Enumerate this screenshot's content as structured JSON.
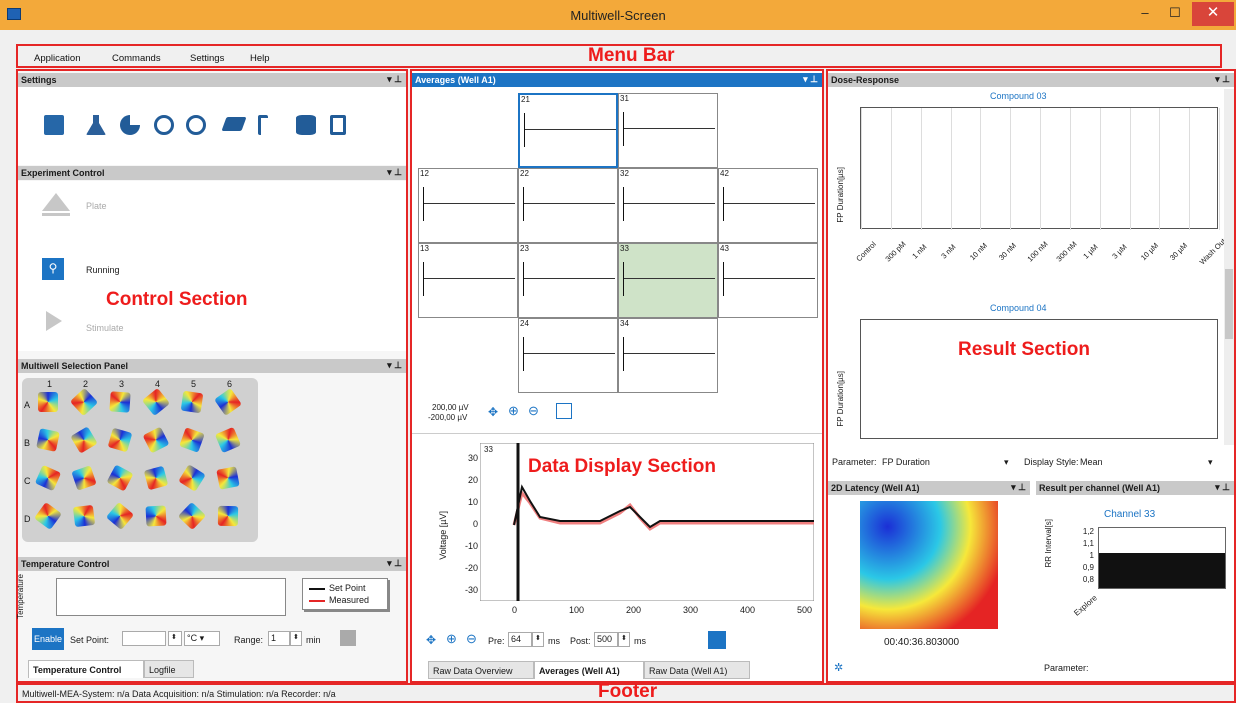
{
  "window": {
    "title": "Multiwell-Screen",
    "minimize": "–",
    "maximize": "☐",
    "close": "✕"
  },
  "menu": [
    "Application",
    "Commands",
    "Settings",
    "Help"
  ],
  "overlays": {
    "menu_bar": "Menu Bar",
    "control_section": "Control Section",
    "data_display_section": "Data Display Section",
    "result_section": "Result Section",
    "footer": "Footer"
  },
  "settings_panel": {
    "title": "Settings",
    "icons": [
      "book-icon",
      "flask-icon",
      "pie-icon",
      "zoom-chart-icon",
      "eraser-icon",
      "pulse-icon",
      "database-icon",
      "clipboard-icon"
    ]
  },
  "experiment_control": {
    "title": "Experiment Control",
    "plate": "Plate",
    "running": "Running",
    "stimulate": "Stimulate"
  },
  "multiwell_panel": {
    "title": "Multiwell Selection Panel",
    "cols": [
      "1",
      "2",
      "3",
      "4",
      "5",
      "6"
    ],
    "rows": [
      "A",
      "B",
      "C",
      "D"
    ]
  },
  "temperature": {
    "title": "Temperature Control",
    "axis": "Temperature",
    "legend_set": "Set Point",
    "legend_measured": "Measured",
    "enable": "Enable",
    "set_point_label": "Set Point:",
    "unit": "°C",
    "range_label": "Range:",
    "range_value": "1",
    "min": "min",
    "tabs": [
      "Temperature Control",
      "Logfile"
    ]
  },
  "averages": {
    "title": "Averages (Well A1)",
    "cells": [
      "21",
      "31",
      "12",
      "22",
      "32",
      "42",
      "13",
      "23",
      "33",
      "43",
      "24",
      "34"
    ],
    "scale_top": "200,00 µV",
    "scale_bottom": "-200,00 µV"
  },
  "detail_plot": {
    "channel": "33",
    "ylabel": "Voltage [µV]",
    "yticks": [
      "30",
      "20",
      "10",
      "0",
      "-10",
      "-20",
      "-30"
    ],
    "xticks": [
      "0",
      "100",
      "200",
      "300",
      "400",
      "500"
    ]
  },
  "data_controls": {
    "pre_label": "Pre:",
    "pre_value": "64",
    "post_label": "Post:",
    "post_value": "500",
    "unit": "ms",
    "tabs": [
      "Raw Data Overview",
      "Averages (Well A1)",
      "Raw Data (Well A1)"
    ]
  },
  "dose_response": {
    "title": "Dose-Response",
    "compound1": "Compound 03",
    "compound2": "Compound 04",
    "ylabel": "FP Duration[µs]",
    "xticks": [
      "Control",
      "300 pM",
      "1 nM",
      "3 nM",
      "10 nM",
      "30 nM",
      "100 nM",
      "300 nM",
      "1 µM",
      "3 µM",
      "10 µM",
      "30 µM",
      "Wash Out"
    ],
    "param_label": "Parameter:",
    "param_value": "FP Duration",
    "style_label": "Display Style:",
    "style_value": "Mean"
  },
  "latency": {
    "title": "2D Latency (Well A1)",
    "time": "00:40:36.803000"
  },
  "per_channel": {
    "title": "Result per channel (Well A1)",
    "channel": "Channel 33",
    "ylabel": "RR Interval[s]",
    "yticks": [
      "1,2",
      "1,1",
      "1",
      "0,9",
      "0,8"
    ],
    "xlabel": "Explore",
    "param_label": "Parameter:"
  },
  "footer": {
    "status": "Multiwell-MEA-System: n/a  Data Acquisition: n/a  Stimulation: n/a  Recorder: n/a"
  }
}
